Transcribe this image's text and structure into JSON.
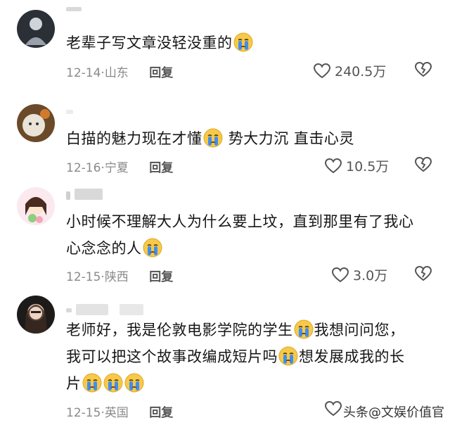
{
  "comments": [
    {
      "text_parts": [
        "老辈子写文章没轻没重的"
      ],
      "date": "12-14",
      "location": "山东",
      "reply_label": "回复",
      "likes": "240.5万"
    },
    {
      "text_parts": [
        "白描的魅力现在才懂",
        "势大力沉 直击心灵"
      ],
      "date": "12-16",
      "location": "宁夏",
      "reply_label": "回复",
      "likes": "10.5万"
    },
    {
      "line1": "小时候不理解大人为什么要上坟，直到那里有了我心",
      "line2": "心念念的人",
      "date": "12-15",
      "location": "陕西",
      "reply_label": "回复",
      "likes": "3.0万"
    },
    {
      "line1a": "老师好，我是伦敦电影学院的学生",
      "line1b": "我想问问您，",
      "line2a": "我可以把这个故事改编成短片吗",
      "line2b": "想发展成我的长",
      "line3": "片",
      "date": "12-15",
      "location": "英国",
      "reply_label": "回复"
    }
  ],
  "watermark": "头条@文娱价值官",
  "icons": {
    "like": "heart-outline-icon",
    "dislike": "broken-heart-icon",
    "emoji": "crying-face-emoji"
  },
  "colors": {
    "text": "#161616",
    "meta": "#8a8a8a",
    "emoji_face": "#f7c948",
    "emoji_tears": "#3d8ff0"
  }
}
